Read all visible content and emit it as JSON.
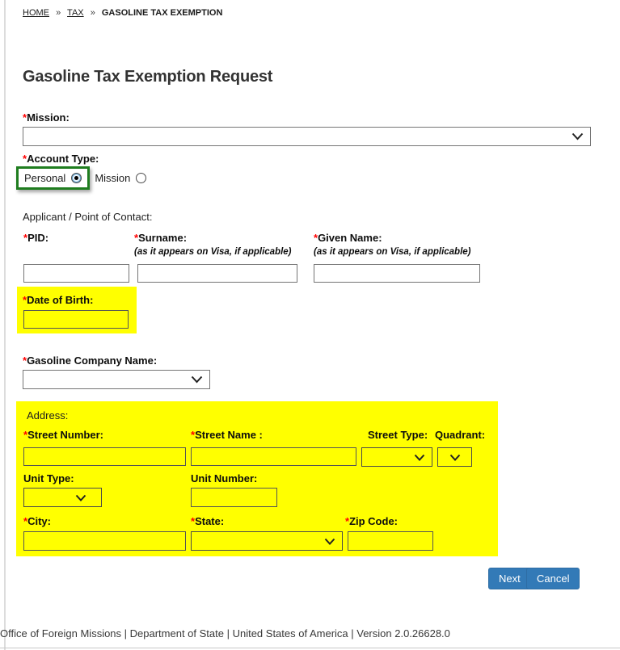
{
  "breadcrumb": {
    "separator": "»",
    "items": [
      {
        "label": "HOME"
      },
      {
        "label": "TAX"
      },
      {
        "label": "GASOLINE TAX EXEMPTION"
      }
    ]
  },
  "page": {
    "title": "Gasoline Tax Exemption Request"
  },
  "form": {
    "required_marker": "*",
    "mission": {
      "label": "Mission:",
      "value": ""
    },
    "account_type": {
      "label": "Account Type:",
      "options": [
        {
          "label": "Personal",
          "selected": true
        },
        {
          "label": "Mission",
          "selected": false
        }
      ]
    },
    "applicant_heading": "Applicant / Point of Contact:",
    "pid": {
      "label": "PID:",
      "value": ""
    },
    "surname": {
      "label": "Surname:",
      "note": "(as it appears on Visa, if applicable)",
      "value": ""
    },
    "given_name": {
      "label": "Given Name:",
      "note": "(as it appears on Visa, if applicable)",
      "value": ""
    },
    "date_of_birth": {
      "label": "Date of Birth:",
      "value": ""
    },
    "gasoline_company": {
      "label": "Gasoline Company Name:",
      "value": ""
    },
    "address": {
      "heading": "Address:",
      "street_number": {
        "label": "Street Number:",
        "value": ""
      },
      "street_name": {
        "label": "Street Name :",
        "value": ""
      },
      "street_type": {
        "label": "Street Type:",
        "value": ""
      },
      "quadrant": {
        "label": "Quadrant:",
        "value": ""
      },
      "unit_type": {
        "label": "Unit Type:",
        "value": ""
      },
      "unit_number": {
        "label": "Unit Number:",
        "value": ""
      },
      "city": {
        "label": "City:",
        "value": ""
      },
      "state": {
        "label": "State:",
        "value": ""
      },
      "zip": {
        "label": "Zip Code:",
        "value": ""
      }
    },
    "buttons": {
      "next": "Next",
      "cancel": "Cancel"
    }
  },
  "footer": {
    "text": "Office of Foreign Missions | Department of State | United States of America | Version 2.0.26628.0"
  },
  "colors": {
    "highlight_yellow": "#ffff00",
    "selection_green": "#1f7d1f",
    "button_blue": "#337ab7",
    "required_red": "#ff0000"
  }
}
